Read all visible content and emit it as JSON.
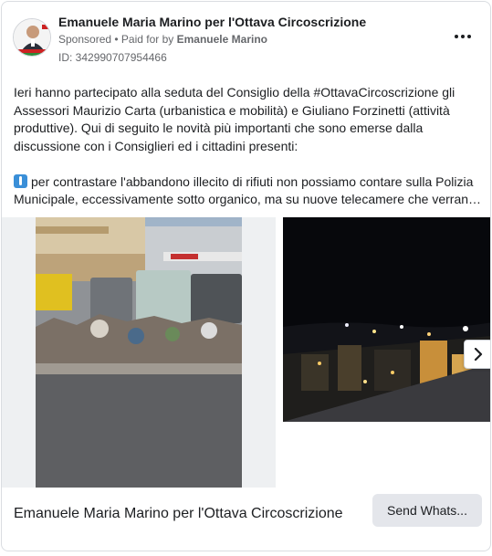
{
  "header": {
    "page_name": "Emanuele Maria Marino per l'Ottava Circoscrizione",
    "sponsored_label": "Sponsored",
    "separator": " • ",
    "paid_for_prefix": "Paid for by ",
    "paid_for_name": "Emanuele Marino",
    "ad_id": "ID: 342990707954466"
  },
  "post": {
    "paragraph_1": "Ieri hanno partecipato alla seduta del Consiglio della #OttavaCircoscrizione gli Assessori Maurizio Carta (urbanistica e mobilità) e Giuliano Forzinetti (attività produttive). Qui di seguito le novità più importanti che sono emerse dalla discussione con i Consiglieri ed i cittadini presenti:",
    "paragraph_2": "per contrastare l'abbandono illecito di rifiuti non possiamo contare sulla Polizia Municipale, eccessivamente sotto organico, ma su nuove telecamere che verrano installate"
  },
  "media": {
    "icons": {
      "next": "chevron-right-icon",
      "more": "more-options-icon",
      "bullet": "emoji-box-icon"
    }
  },
  "footer": {
    "title": "Emanuele Maria Marino per l'Ottava Circoscrizione",
    "cta_label": "Send Whats..."
  }
}
